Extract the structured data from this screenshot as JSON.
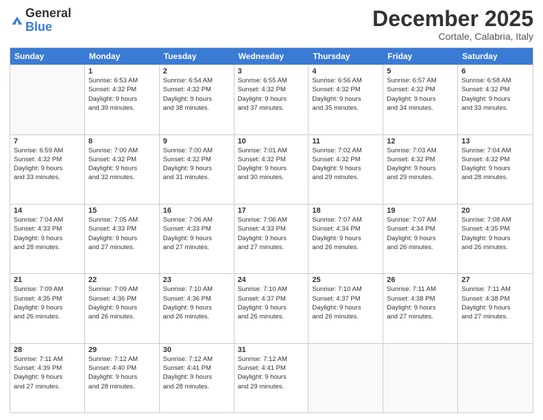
{
  "logo": {
    "general": "General",
    "blue": "Blue"
  },
  "title": "December 2025",
  "subtitle": "Cortale, Calabria, Italy",
  "header": {
    "days": [
      "Sunday",
      "Monday",
      "Tuesday",
      "Wednesday",
      "Thursday",
      "Friday",
      "Saturday"
    ]
  },
  "weeks": [
    [
      {
        "day": "",
        "empty": true
      },
      {
        "day": "1",
        "line1": "Sunrise: 6:53 AM",
        "line2": "Sunset: 4:32 PM",
        "line3": "Daylight: 9 hours",
        "line4": "and 39 minutes."
      },
      {
        "day": "2",
        "line1": "Sunrise: 6:54 AM",
        "line2": "Sunset: 4:32 PM",
        "line3": "Daylight: 9 hours",
        "line4": "and 38 minutes."
      },
      {
        "day": "3",
        "line1": "Sunrise: 6:55 AM",
        "line2": "Sunset: 4:32 PM",
        "line3": "Daylight: 9 hours",
        "line4": "and 37 minutes."
      },
      {
        "day": "4",
        "line1": "Sunrise: 6:56 AM",
        "line2": "Sunset: 4:32 PM",
        "line3": "Daylight: 9 hours",
        "line4": "and 35 minutes."
      },
      {
        "day": "5",
        "line1": "Sunrise: 6:57 AM",
        "line2": "Sunset: 4:32 PM",
        "line3": "Daylight: 9 hours",
        "line4": "and 34 minutes."
      },
      {
        "day": "6",
        "line1": "Sunrise: 6:58 AM",
        "line2": "Sunset: 4:32 PM",
        "line3": "Daylight: 9 hours",
        "line4": "and 33 minutes."
      }
    ],
    [
      {
        "day": "7",
        "line1": "Sunrise: 6:59 AM",
        "line2": "Sunset: 4:32 PM",
        "line3": "Daylight: 9 hours",
        "line4": "and 33 minutes."
      },
      {
        "day": "8",
        "line1": "Sunrise: 7:00 AM",
        "line2": "Sunset: 4:32 PM",
        "line3": "Daylight: 9 hours",
        "line4": "and 32 minutes."
      },
      {
        "day": "9",
        "line1": "Sunrise: 7:00 AM",
        "line2": "Sunset: 4:32 PM",
        "line3": "Daylight: 9 hours",
        "line4": "and 31 minutes."
      },
      {
        "day": "10",
        "line1": "Sunrise: 7:01 AM",
        "line2": "Sunset: 4:32 PM",
        "line3": "Daylight: 9 hours",
        "line4": "and 30 minutes."
      },
      {
        "day": "11",
        "line1": "Sunrise: 7:02 AM",
        "line2": "Sunset: 4:32 PM",
        "line3": "Daylight: 9 hours",
        "line4": "and 29 minutes."
      },
      {
        "day": "12",
        "line1": "Sunrise: 7:03 AM",
        "line2": "Sunset: 4:32 PM",
        "line3": "Daylight: 9 hours",
        "line4": "and 29 minutes."
      },
      {
        "day": "13",
        "line1": "Sunrise: 7:04 AM",
        "line2": "Sunset: 4:32 PM",
        "line3": "Daylight: 9 hours",
        "line4": "and 28 minutes."
      }
    ],
    [
      {
        "day": "14",
        "line1": "Sunrise: 7:04 AM",
        "line2": "Sunset: 4:33 PM",
        "line3": "Daylight: 9 hours",
        "line4": "and 28 minutes."
      },
      {
        "day": "15",
        "line1": "Sunrise: 7:05 AM",
        "line2": "Sunset: 4:33 PM",
        "line3": "Daylight: 9 hours",
        "line4": "and 27 minutes."
      },
      {
        "day": "16",
        "line1": "Sunrise: 7:06 AM",
        "line2": "Sunset: 4:33 PM",
        "line3": "Daylight: 9 hours",
        "line4": "and 27 minutes."
      },
      {
        "day": "17",
        "line1": "Sunrise: 7:06 AM",
        "line2": "Sunset: 4:33 PM",
        "line3": "Daylight: 9 hours",
        "line4": "and 27 minutes."
      },
      {
        "day": "18",
        "line1": "Sunrise: 7:07 AM",
        "line2": "Sunset: 4:34 PM",
        "line3": "Daylight: 9 hours",
        "line4": "and 26 minutes."
      },
      {
        "day": "19",
        "line1": "Sunrise: 7:07 AM",
        "line2": "Sunset: 4:34 PM",
        "line3": "Daylight: 9 hours",
        "line4": "and 26 minutes."
      },
      {
        "day": "20",
        "line1": "Sunrise: 7:08 AM",
        "line2": "Sunset: 4:35 PM",
        "line3": "Daylight: 9 hours",
        "line4": "and 26 minutes."
      }
    ],
    [
      {
        "day": "21",
        "line1": "Sunrise: 7:09 AM",
        "line2": "Sunset: 4:35 PM",
        "line3": "Daylight: 9 hours",
        "line4": "and 26 minutes."
      },
      {
        "day": "22",
        "line1": "Sunrise: 7:09 AM",
        "line2": "Sunset: 4:36 PM",
        "line3": "Daylight: 9 hours",
        "line4": "and 26 minutes."
      },
      {
        "day": "23",
        "line1": "Sunrise: 7:10 AM",
        "line2": "Sunset: 4:36 PM",
        "line3": "Daylight: 9 hours",
        "line4": "and 26 minutes."
      },
      {
        "day": "24",
        "line1": "Sunrise: 7:10 AM",
        "line2": "Sunset: 4:37 PM",
        "line3": "Daylight: 9 hours",
        "line4": "and 26 minutes."
      },
      {
        "day": "25",
        "line1": "Sunrise: 7:10 AM",
        "line2": "Sunset: 4:37 PM",
        "line3": "Daylight: 9 hours",
        "line4": "and 26 minutes."
      },
      {
        "day": "26",
        "line1": "Sunrise: 7:11 AM",
        "line2": "Sunset: 4:38 PM",
        "line3": "Daylight: 9 hours",
        "line4": "and 27 minutes."
      },
      {
        "day": "27",
        "line1": "Sunrise: 7:11 AM",
        "line2": "Sunset: 4:38 PM",
        "line3": "Daylight: 9 hours",
        "line4": "and 27 minutes."
      }
    ],
    [
      {
        "day": "28",
        "line1": "Sunrise: 7:11 AM",
        "line2": "Sunset: 4:39 PM",
        "line3": "Daylight: 9 hours",
        "line4": "and 27 minutes."
      },
      {
        "day": "29",
        "line1": "Sunrise: 7:12 AM",
        "line2": "Sunset: 4:40 PM",
        "line3": "Daylight: 9 hours",
        "line4": "and 28 minutes."
      },
      {
        "day": "30",
        "line1": "Sunrise: 7:12 AM",
        "line2": "Sunset: 4:41 PM",
        "line3": "Daylight: 9 hours",
        "line4": "and 28 minutes."
      },
      {
        "day": "31",
        "line1": "Sunrise: 7:12 AM",
        "line2": "Sunset: 4:41 PM",
        "line3": "Daylight: 9 hours",
        "line4": "and 29 minutes."
      },
      {
        "day": "",
        "empty": true
      },
      {
        "day": "",
        "empty": true
      },
      {
        "day": "",
        "empty": true
      }
    ]
  ]
}
